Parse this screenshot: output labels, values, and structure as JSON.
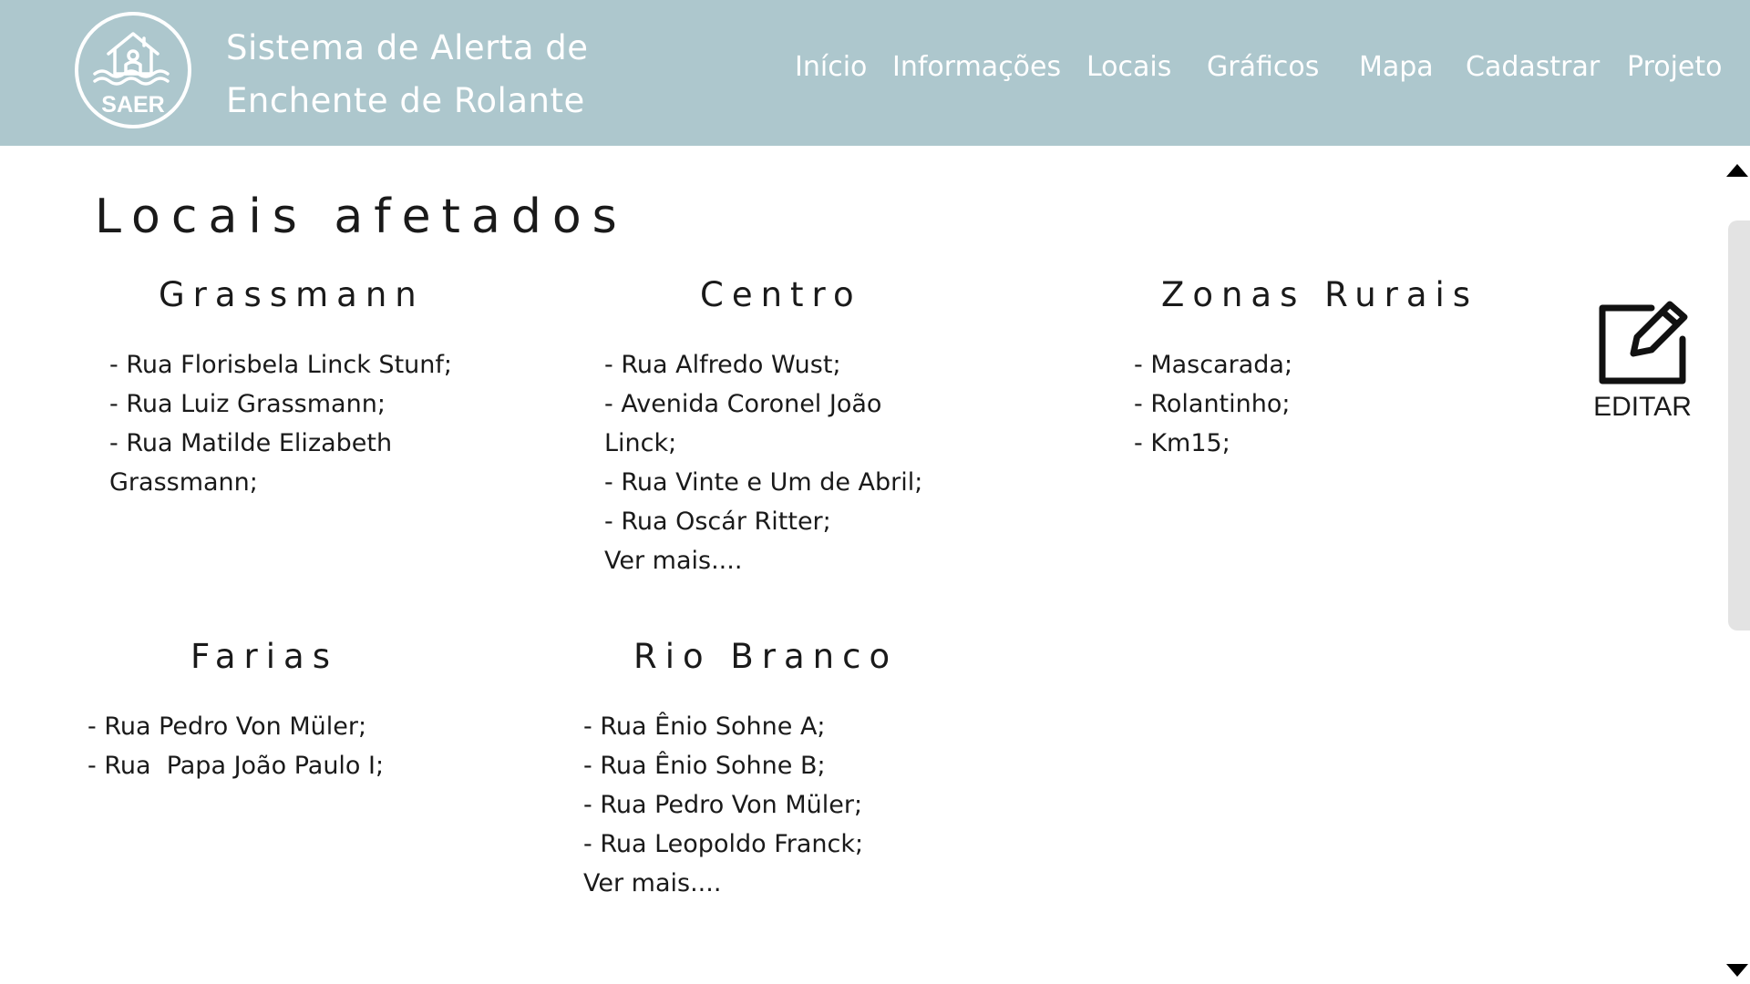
{
  "header": {
    "logo_text": "SAER",
    "title_line1": "Sistema de Alerta de",
    "title_line2": "Enchente de Rolante",
    "nav": [
      "Início",
      "Informações",
      "Locais",
      "Gráficos",
      "Mapa",
      "Cadastrar",
      "Projeto"
    ]
  },
  "page": {
    "title": "Locais afetados"
  },
  "sections": [
    {
      "title": "Grassmann",
      "lines": [
        "- Rua Florisbela Linck Stunf;",
        "- Rua Luiz Grassmann;",
        "- Rua Matilde Elizabeth",
        "Grassmann;"
      ]
    },
    {
      "title": "Centro",
      "lines": [
        "- Rua Alfredo Wust;",
        "- Avenida Coronel João",
        "Linck;",
        "- Rua Vinte e Um de Abril;",
        "- Rua Oscár Ritter;"
      ],
      "more": "Ver mais...."
    },
    {
      "title": "Zonas Rurais",
      "lines": [
        "- Mascarada;",
        "- Rolantinho;",
        "- Km15;"
      ]
    },
    {
      "title": "Farias",
      "lines": [
        "- Rua Pedro Von Müler;",
        "- Rua  Papa João Paulo I;"
      ]
    },
    {
      "title": "Rio Branco",
      "lines": [
        "- Rua Ênio Sohne A;",
        "- Rua Ênio Sohne B;",
        "- Rua Pedro Von Müler;",
        "- Rua Leopoldo Franck;"
      ],
      "more": "Ver mais...."
    }
  ],
  "edit": {
    "label": "EDITAR",
    "icon": "edit-icon"
  }
}
